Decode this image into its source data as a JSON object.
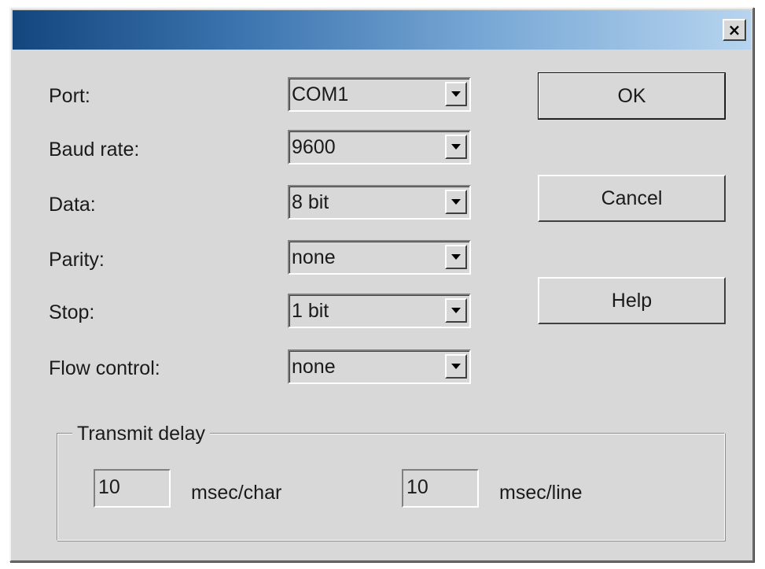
{
  "window": {
    "title": "",
    "close_label": "×"
  },
  "fields": [
    {
      "label": "Port:",
      "value": "COM1"
    },
    {
      "label": "Baud rate:",
      "value": "9600"
    },
    {
      "label": "Data:",
      "value": "8 bit"
    },
    {
      "label": "Parity:",
      "value": "none"
    },
    {
      "label": "Stop:",
      "value": "1 bit"
    },
    {
      "label": "Flow control:",
      "value": "none"
    }
  ],
  "buttons": {
    "ok": "OK",
    "cancel": "Cancel",
    "help": "Help"
  },
  "transmit_delay": {
    "title": "Transmit delay",
    "char_value": "10",
    "char_unit": "msec/char",
    "line_value": "10",
    "line_unit": "msec/line"
  },
  "icons": {
    "close": "close-icon",
    "dropdown": "chevron-down-icon"
  },
  "colors": {
    "dialog_bg": "#d8d8d8",
    "titlebar_start": "#14467e",
    "titlebar_end": "#b6d4ef"
  }
}
